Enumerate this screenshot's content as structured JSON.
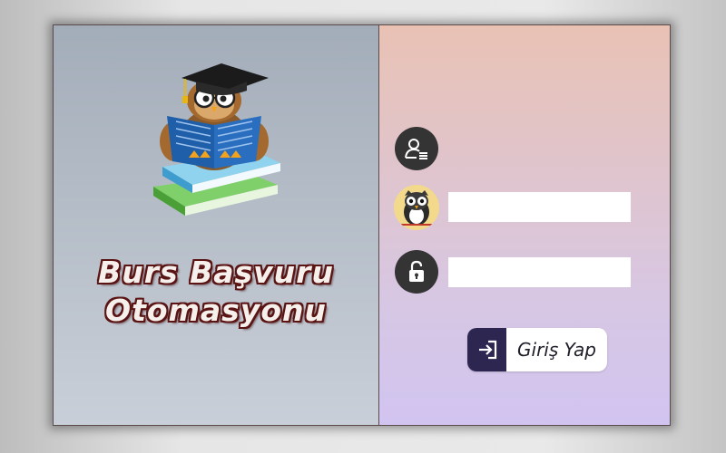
{
  "app": {
    "title_line1": "Burs Başvuru",
    "title_line2": "Otomasyonu",
    "logo_icon": "owl-graduate-reading-books-icon"
  },
  "login_form": {
    "user_icon": "user-id-icon",
    "avatar_icon": "owl-avatar-icon",
    "username_value": "",
    "lock_icon": "padlock-icon",
    "password_value": "",
    "login_button_label": "Giriş Yap",
    "login_button_icon": "sign-in-icon"
  },
  "colors": {
    "icon_circle": "#343434",
    "login_icon_bg": "#2d2650",
    "title_outline": "#5a1414"
  }
}
